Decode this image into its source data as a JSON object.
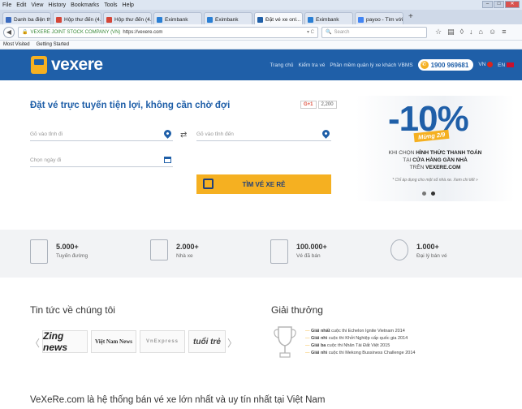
{
  "browser": {
    "menu": [
      "File",
      "Edit",
      "View",
      "History",
      "Bookmarks",
      "Tools",
      "Help"
    ],
    "tabs": [
      {
        "label": "Danh ba điện th...",
        "color": "#3b6bbf",
        "active": false
      },
      {
        "label": "Hộp thư đến (4...",
        "color": "#d44638",
        "active": false
      },
      {
        "label": "Hộp thư đến (4...",
        "color": "#d44638",
        "active": false
      },
      {
        "label": "Eximbank",
        "color": "#2a7fd4",
        "active": false
      },
      {
        "label": "Eximbank",
        "color": "#2a7fd4",
        "active": false
      },
      {
        "label": "Đặt vé xe onl...",
        "color": "#1f5fa8",
        "active": true
      },
      {
        "label": "Eximbank",
        "color": "#2a7fd4",
        "active": false
      },
      {
        "label": "payoo - Tìm với...",
        "color": "#4285f4",
        "active": false
      }
    ],
    "url_org": "VEXERE JOINT STOCK COMPANY (VN)",
    "url": "https://vexere.com",
    "search_placeholder": "Search",
    "bookmarks": [
      "Most Visited",
      "Getting Started"
    ]
  },
  "header": {
    "logo": "vexere",
    "nav": [
      "Trang chủ",
      "Kiểm tra vé",
      "Phần mềm quản lý xe khách VBMS"
    ],
    "hotline": "1900 969681",
    "lang_vn": "VN",
    "lang_en": "EN"
  },
  "booking": {
    "title": "Đặt vé trực tuyến tiện lợi, không cần chờ đợi",
    "gplus_label": "G+1",
    "gplus_count": "2,200",
    "from_placeholder": "Gõ vào tỉnh đi",
    "to_placeholder": "Gõ vào tỉnh đến",
    "date_placeholder": "Chọn ngày đi",
    "search_button": "TÌM VÉ XE RẺ"
  },
  "promo": {
    "discount": "-10%",
    "occasion": "Mừng 2/9",
    "line1_pre": "KHI CHỌN",
    "line1_bold": "HÌNH THỨC THANH TOÁN",
    "line2_pre": "TẠI",
    "line2_bold": "CỬA HÀNG GẦN NHÀ",
    "line3_pre": "TRÊN",
    "line3_bold": "VEXERE.COM",
    "note": "* Chỉ áp dụng cho một số nhà xe. Xem chi tiết »"
  },
  "stats": [
    {
      "value": "5.000+",
      "label": "Tuyến đường",
      "icon": "building-icon"
    },
    {
      "value": "2.000+",
      "label": "Nhà xe",
      "icon": "bus-icon"
    },
    {
      "value": "100.000+",
      "label": "Vé đã bán",
      "icon": "ticket-icon"
    },
    {
      "value": "1.000+",
      "label": "Đại lý bán vé",
      "icon": "location-icon"
    }
  ],
  "news": {
    "title": "Tin tức về chúng tôi",
    "logos": [
      "Zing news",
      "Việt Nam News",
      "VnExpress",
      "tuổi trẻ"
    ]
  },
  "awards": {
    "title": "Giải thưởng",
    "items": [
      {
        "rank": "Giải nhất",
        "text": "cuộc thi Echelon Ignite Vietnam 2014"
      },
      {
        "rank": "Giải nhì",
        "text": "cuộc thi Khởi Nghiệp cấp quốc gia 2014"
      },
      {
        "rank": "Giải ba",
        "text": "cuộc thi Nhân Tài Đất Việt 2015"
      },
      {
        "rank": "Giải nhì",
        "text": "cuộc thi Mekong Bussiness Challenge 2014"
      }
    ]
  },
  "footer": {
    "headline": "VeXeRe.com là hệ thống bán vé xe lớn nhất và uy tín nhất tại Việt Nam"
  }
}
